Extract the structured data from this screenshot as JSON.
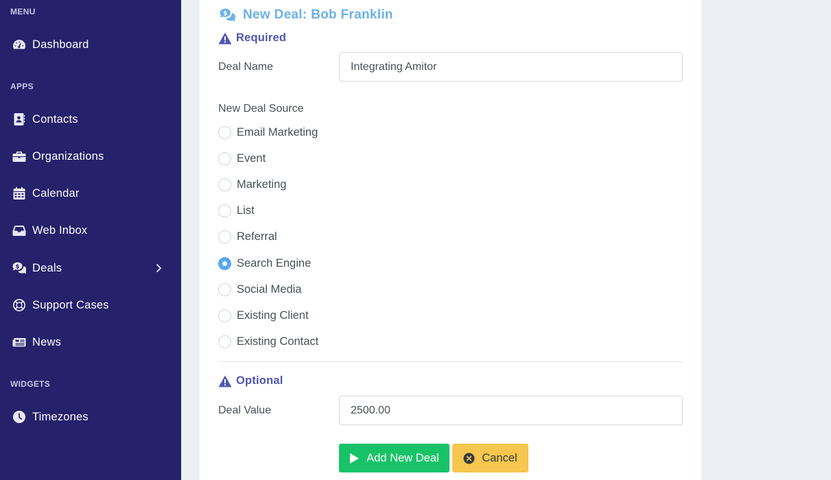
{
  "sidebar": {
    "sections": {
      "menu": "MENU",
      "apps": "APPS",
      "widgets": "WIDGETS"
    },
    "items": [
      {
        "label": "Dashboard",
        "icon": "tachometer-icon"
      },
      {
        "label": "Contacts",
        "icon": "address-book-icon"
      },
      {
        "label": "Organizations",
        "icon": "briefcase-icon"
      },
      {
        "label": "Calendar",
        "icon": "calendar-icon"
      },
      {
        "label": "Web Inbox",
        "icon": "inbox-icon"
      },
      {
        "label": "Deals",
        "icon": "comments-dollar-icon"
      },
      {
        "label": "Support Cases",
        "icon": "life-ring-icon"
      },
      {
        "label": "News",
        "icon": "newspaper-icon"
      },
      {
        "label": "Timezones",
        "icon": "clock-icon"
      }
    ]
  },
  "form": {
    "title": "New Deal: Bob Franklin",
    "required_heading": "Required",
    "deal_name_label": "Deal Name",
    "deal_name_value": "Integrating Amitor",
    "source_label": "New Deal Source",
    "sources": [
      "Email Marketing",
      "Event",
      "Marketing",
      "List",
      "Referral",
      "Search Engine",
      "Social Media",
      "Existing Client",
      "Existing Contact"
    ],
    "selected_source": "Search Engine",
    "optional_heading": "Optional",
    "deal_value_label": "Deal Value",
    "deal_value_value": "2500.00",
    "add_button": "Add New Deal",
    "cancel_button": "Cancel"
  },
  "colors": {
    "sidebar_bg": "#25216a",
    "title_blue": "#6cb1ea",
    "heading_indigo": "#4f56b3",
    "add_green": "#18c368",
    "cancel_yellow": "#f6c64e",
    "radio_checked": "#5aa7ee"
  }
}
